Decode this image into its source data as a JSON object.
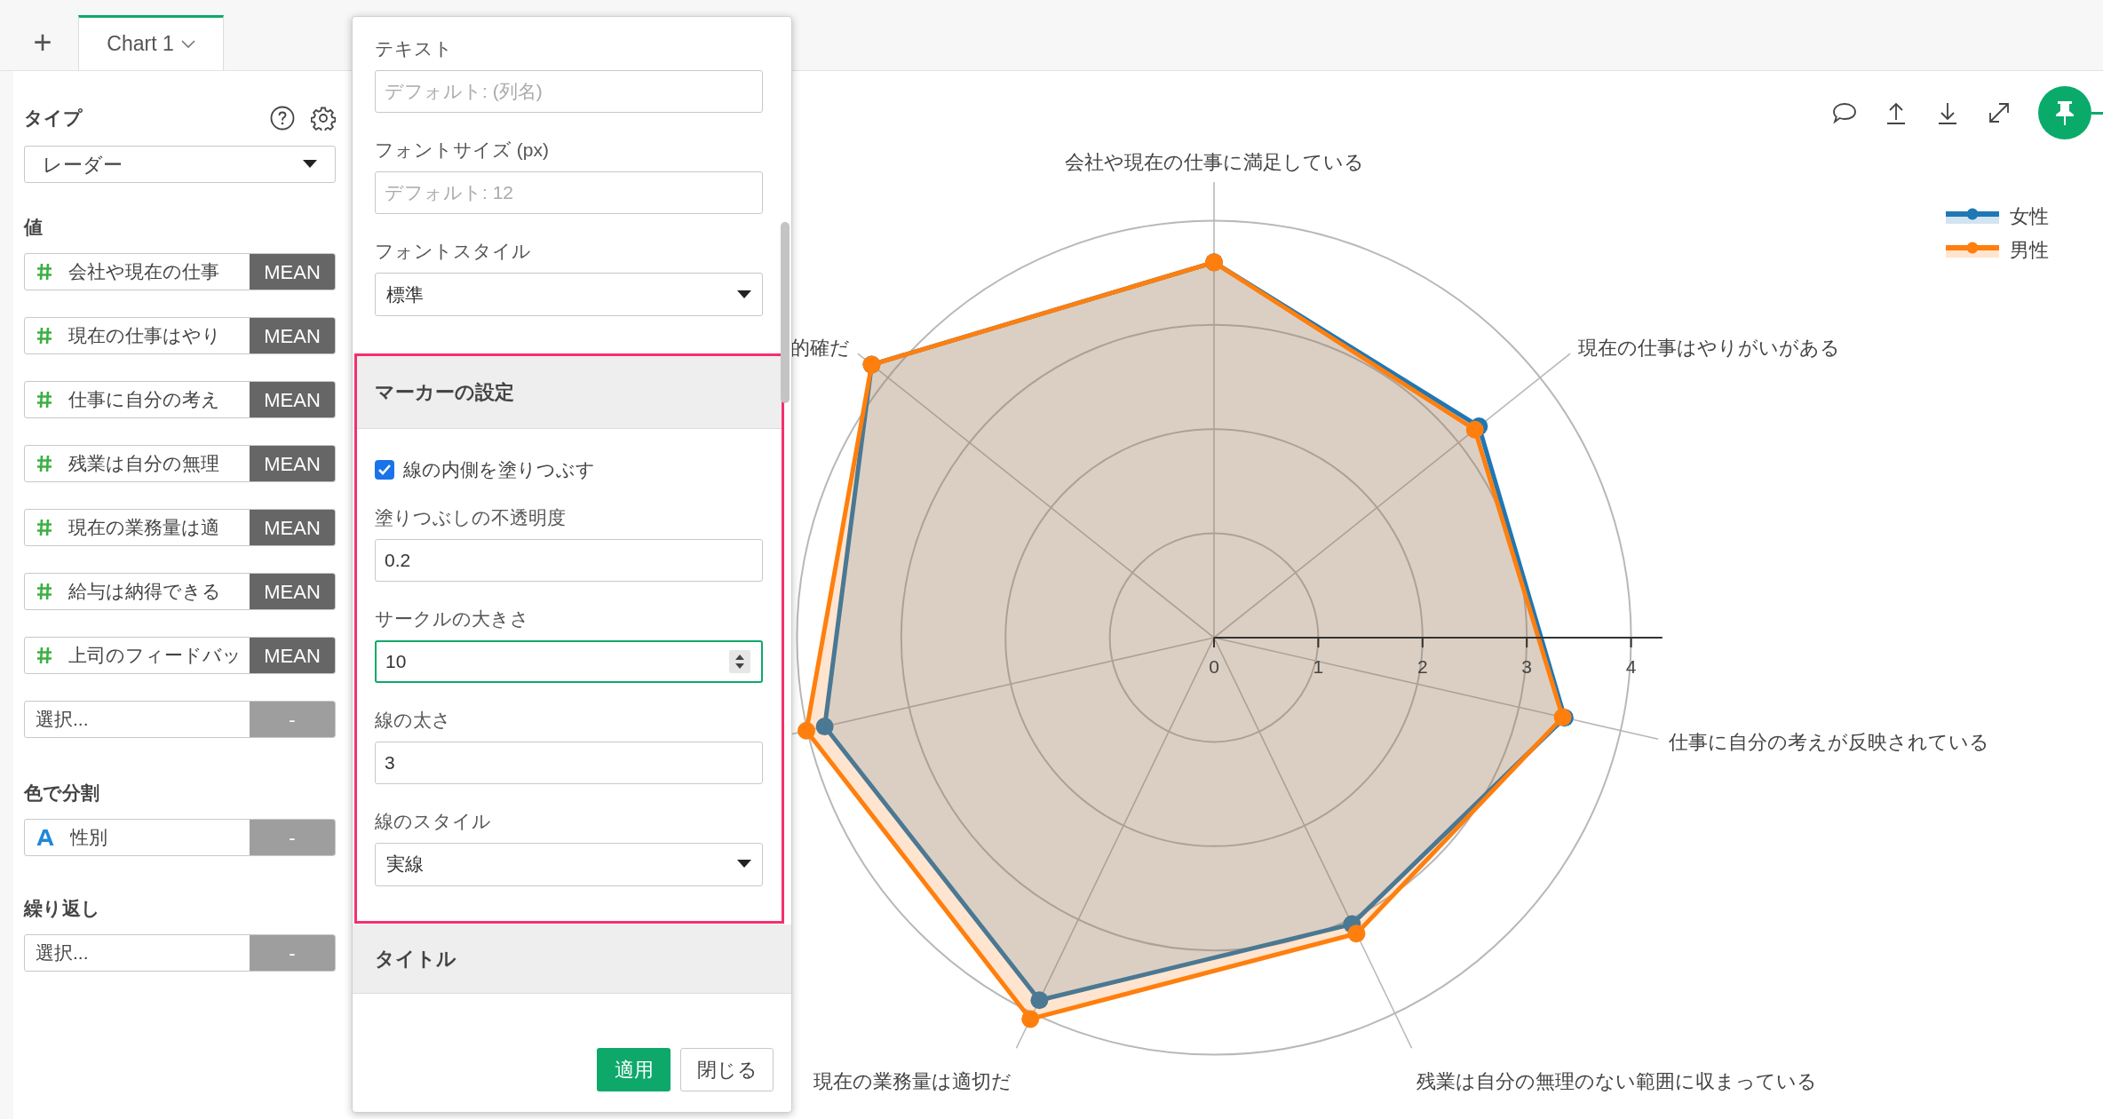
{
  "tabs": {
    "add_button": "+",
    "items": [
      {
        "label": "Chart 1",
        "selected": true
      }
    ]
  },
  "sidebar": {
    "type_label": "タイプ",
    "type_value": "レーダー",
    "values_label": "値",
    "values": [
      {
        "kind": "number",
        "name": "会社や現在の仕事",
        "aggregate": "MEAN"
      },
      {
        "kind": "number",
        "name": "現在の仕事はやり",
        "aggregate": "MEAN"
      },
      {
        "kind": "number",
        "name": "仕事に自分の考え",
        "aggregate": "MEAN"
      },
      {
        "kind": "number",
        "name": "残業は自分の無理",
        "aggregate": "MEAN"
      },
      {
        "kind": "number",
        "name": "現在の業務量は適",
        "aggregate": "MEAN"
      },
      {
        "kind": "number",
        "name": "給与は納得できる",
        "aggregate": "MEAN"
      },
      {
        "kind": "number",
        "name": "上司のフィードバッ",
        "aggregate": "MEAN"
      }
    ],
    "values_add": {
      "placeholder": "選択...",
      "action": "-"
    },
    "color_label": "色で分割",
    "color_field": {
      "kind": "text",
      "name": "性別",
      "action": "-"
    },
    "repeat_label": "繰り返し",
    "repeat_add": {
      "placeholder": "選択...",
      "action": "-"
    }
  },
  "settings_popup": {
    "fields": [
      {
        "kind": "input",
        "label": "テキスト",
        "placeholder": "デフォルト: (列名)"
      },
      {
        "kind": "input",
        "label": "フォントサイズ (px)",
        "placeholder": "デフォルト: 12"
      },
      {
        "kind": "select",
        "label": "フォントスタイル",
        "value": "標準"
      }
    ],
    "marker_section": {
      "title": "マーカーの設定",
      "highlighted": true,
      "checkbox": {
        "label": "線の内側を塗りつぶす",
        "checked": true
      },
      "fields": [
        {
          "kind": "input",
          "label": "塗りつぶしの不透明度",
          "value": "0.2"
        },
        {
          "kind": "spinner",
          "label": "サークルの大きさ",
          "value": "10",
          "focused": true
        },
        {
          "kind": "input",
          "label": "線の太さ",
          "value": "3"
        },
        {
          "kind": "select",
          "label": "線のスタイル",
          "value": "実線"
        }
      ]
    },
    "title_section": {
      "title": "タイトル"
    },
    "buttons": [
      {
        "kind": "primary",
        "label": "適用"
      },
      {
        "kind": "secondary",
        "label": "閉じる"
      }
    ]
  },
  "chart": {
    "axis_labels": [
      "会社や現在の仕事に満足している",
      "的確だ",
      "現在の仕事はやりがいがある",
      "仕事に自分の考えが反映されている",
      "現在の業務量は適切だ",
      "残業は自分の無理のない範囲に収まっている"
    ],
    "ticks": [
      "0",
      "1",
      "2",
      "3",
      "4"
    ],
    "legend": [
      {
        "name": "女性",
        "color": "#1f77b4"
      },
      {
        "name": "男性",
        "color": "#ff7f0e"
      }
    ]
  }
}
